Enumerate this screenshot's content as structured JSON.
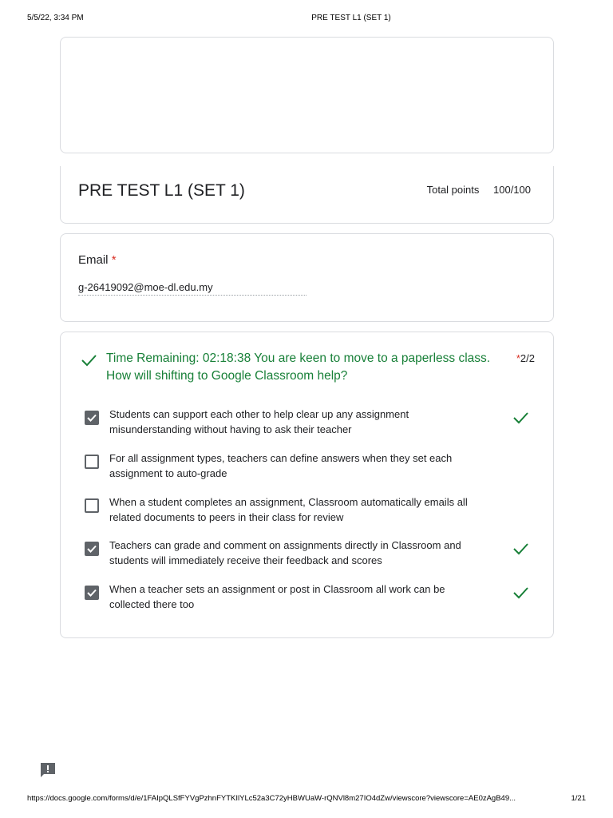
{
  "print_header": {
    "datetime": "5/5/22, 3:34 PM",
    "title": "PRE TEST L1 (SET 1)"
  },
  "form": {
    "title": "PRE TEST L1 (SET 1)",
    "total_points_label": "Total points",
    "total_points_value": "100/100"
  },
  "email": {
    "label": "Email",
    "required_mark": "*",
    "value": "g-26419092@moe-dl.edu.my"
  },
  "question": {
    "text_line1": "Time Remaining: 02:18:38 You are keen to move to a paperless class.",
    "text_line2": "How will shifting to Google Classroom help?",
    "required_mark": "*",
    "score": "2/2",
    "options": [
      {
        "line1": "Students can support each other to help clear up any assignment",
        "line2": "misunderstanding without having to ask their teacher",
        "checked": true,
        "correct": true
      },
      {
        "line1": "For all assignment types, teachers can define answers when they set each",
        "line2": "assignment to auto-grade",
        "checked": false,
        "correct": false
      },
      {
        "line1": "When a student completes an assignment, Classroom automatically emails all",
        "line2": "related documents to peers in their class for review",
        "checked": false,
        "correct": false
      },
      {
        "line1": "Teachers can grade and comment on assignments directly in Classroom and",
        "line2": "students will immediately receive their feedback and scores",
        "checked": true,
        "correct": true
      },
      {
        "line1": "When a teacher sets an assignment or post in Classroom all work can be",
        "line2": "collected there too",
        "checked": true,
        "correct": true
      }
    ]
  },
  "colors": {
    "correct_green": "#188038",
    "required_red": "#d93025",
    "checkbox_gray": "#5f6368"
  },
  "icons": {
    "question_status": "check-icon",
    "option_checked": "checkbox-checked-icon",
    "option_unchecked": "checkbox-empty-icon",
    "option_correct": "check-icon",
    "feedback": "feedback-icon"
  },
  "print_footer": {
    "url": "https://docs.google.com/forms/d/e/1FAIpQLSfFYVgPzhnFYTKIlYLc52a3C72yHBWUaW-rQNVl8m27IO4dZw/viewscore?viewscore=AE0zAgB49...",
    "page": "1/21"
  }
}
